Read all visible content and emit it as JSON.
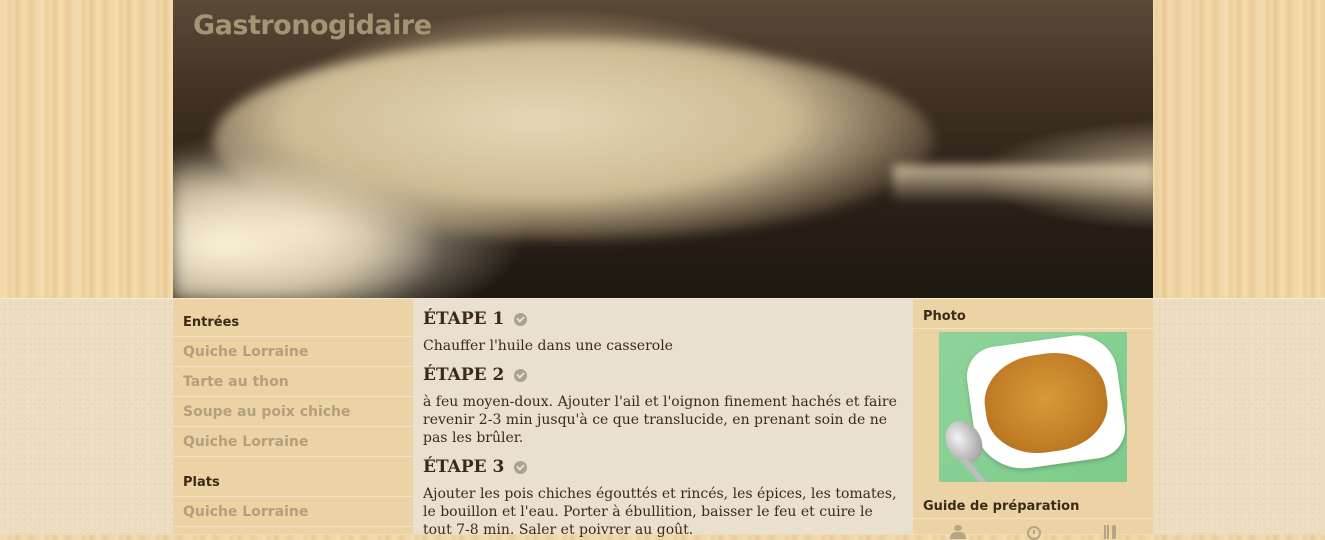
{
  "site": {
    "title": "Gastronogidaire"
  },
  "sidebar": {
    "sections": [
      {
        "title": "Entrées",
        "items": [
          "Quiche Lorraine",
          "Tarte au thon",
          "Soupe au poix chiche",
          "Quiche Lorraine"
        ]
      },
      {
        "title": "Plats",
        "items": [
          "Quiche Lorraine"
        ]
      }
    ]
  },
  "main": {
    "steps": [
      {
        "title": "ÉTAPE 1",
        "text": "Chauffer l'huile dans une casserole"
      },
      {
        "title": "ÉTAPE 2",
        "text": "à feu moyen-doux. Ajouter l'ail et l'oignon finement hachés et faire revenir 2-3 min jusqu'à ce que translucide, en prenant soin de ne pas les brûler."
      },
      {
        "title": "ÉTAPE 3",
        "text": "Ajouter les pois chiches égouttés et rincés, les épices, les tomates, le bouillon et l'eau. Porter à ébullition, baisser le feu et cuire le tout 7-8 min. Saler et poivrer au goût."
      }
    ],
    "step_icon": "check-circle-icon"
  },
  "right": {
    "photo_title": "Photo",
    "guide_title": "Guide de préparation",
    "guide_icons": [
      "users-icon",
      "clock-icon",
      "cutlery-icon"
    ]
  },
  "colors": {
    "sidebar_bg": "#ecd3a6",
    "main_bg": "#eae0cf",
    "heading": "#3a2b16",
    "link": "#b2a07c"
  }
}
